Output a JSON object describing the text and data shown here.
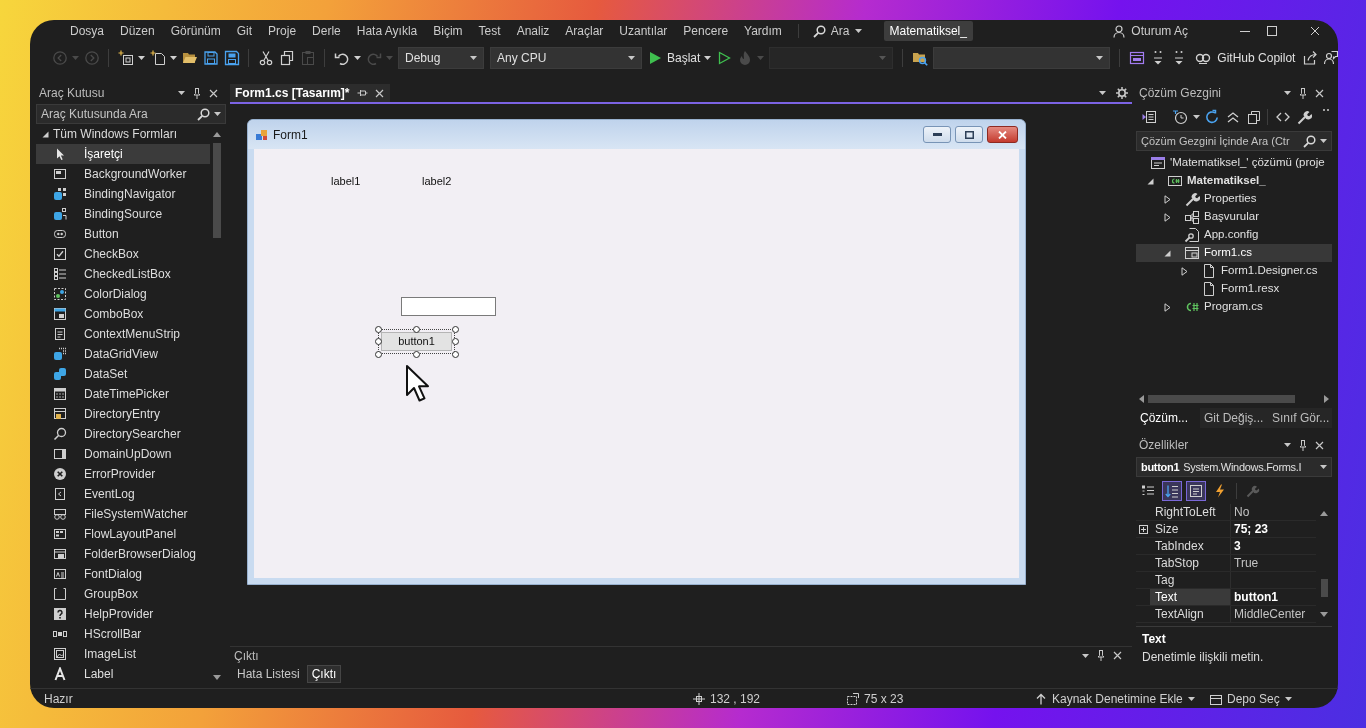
{
  "menu_bar": {
    "items": [
      "Dosya",
      "Düzen",
      "Görünüm",
      "Git",
      "Proje",
      "Derle",
      "Hata Ayıkla",
      "Biçim",
      "Test",
      "Analiz",
      "Araçlar",
      "Uzantılar",
      "Pencere",
      "Yardım"
    ],
    "search": "Ara",
    "solution": "Matematiksel_",
    "account": "Oturum Aç"
  },
  "toolbar": {
    "items": [
      {
        "kind": "back",
        "disabled": true,
        "dropdown": true
      },
      {
        "kind": "forward",
        "disabled": true,
        "dropdown": false
      },
      {
        "kind": "separator"
      },
      {
        "kind": "new-project",
        "disabled": false,
        "dropdown": true
      },
      {
        "kind": "new-item",
        "disabled": false,
        "dropdown": true
      },
      {
        "kind": "open",
        "disabled": false,
        "dropdown": false
      },
      {
        "kind": "save",
        "disabled": false,
        "dropdown": false
      },
      {
        "kind": "save-all",
        "disabled": false,
        "dropdown": false
      },
      {
        "kind": "separator"
      },
      {
        "kind": "cut",
        "disabled": false,
        "dropdown": false
      },
      {
        "kind": "copy",
        "disabled": false,
        "dropdown": false
      },
      {
        "kind": "paste",
        "disabled": true,
        "dropdown": false
      },
      {
        "kind": "separator"
      },
      {
        "kind": "undo",
        "disabled": false,
        "dropdown": true
      },
      {
        "kind": "redo",
        "disabled": true,
        "dropdown": true
      },
      {
        "kind": "combo",
        "value": "Debug",
        "disabled": false
      },
      {
        "kind": "combo",
        "value": "Any CPU",
        "disabled": false
      },
      {
        "kind": "start",
        "label": "Başlat",
        "disabled": false,
        "dropdown": true
      },
      {
        "kind": "run",
        "disabled": false,
        "dropdown": false
      },
      {
        "kind": "hot-reload",
        "disabled": true,
        "dropdown": true
      },
      {
        "kind": "combo",
        "disabled": true
      },
      {
        "kind": "separator"
      },
      {
        "kind": "find",
        "disabled": false,
        "dropdown": false
      },
      {
        "kind": "combo",
        "disabled": false
      },
      {
        "kind": "separator"
      },
      {
        "kind": "layout",
        "disabled": false,
        "dropdown": false
      },
      {
        "kind": "overflow",
        "disabled": false,
        "dropdown": false
      },
      {
        "kind": "overflow",
        "disabled": false,
        "dropdown": false
      },
      {
        "kind": "copilot",
        "label": "GitHub Copilot",
        "disabled": false,
        "dropdown": false
      },
      {
        "kind": "share",
        "disabled": false,
        "dropdown": false
      },
      {
        "kind": "feedback",
        "disabled": false,
        "dropdown": false
      }
    ]
  },
  "toolbox": {
    "title": "Araç Kutusu",
    "search": {
      "placeholder": "Araç Kutusunda Ara"
    },
    "group": {
      "label": "Tüm Windows Formları",
      "expanded": true
    },
    "items": [
      {
        "label": "İşaretçi",
        "selected": true
      },
      {
        "label": "BackgroundWorker",
        "selected": false
      },
      {
        "label": "BindingNavigator",
        "selected": false
      },
      {
        "label": "BindingSource",
        "selected": false
      },
      {
        "label": "Button",
        "selected": false
      },
      {
        "label": "CheckBox",
        "selected": false
      },
      {
        "label": "CheckedListBox",
        "selected": false
      },
      {
        "label": "ColorDialog",
        "selected": false
      },
      {
        "label": "ComboBox",
        "selected": false
      },
      {
        "label": "ContextMenuStrip",
        "selected": false
      },
      {
        "label": "DataGridView",
        "selected": false
      },
      {
        "label": "DataSet",
        "selected": false
      },
      {
        "label": "DateTimePicker",
        "selected": false
      },
      {
        "label": "DirectoryEntry",
        "selected": false
      },
      {
        "label": "DirectorySearcher",
        "selected": false
      },
      {
        "label": "DomainUpDown",
        "selected": false
      },
      {
        "label": "ErrorProvider",
        "selected": false
      },
      {
        "label": "EventLog",
        "selected": false
      },
      {
        "label": "FileSystemWatcher",
        "selected": false
      },
      {
        "label": "FlowLayoutPanel",
        "selected": false
      },
      {
        "label": "FolderBrowserDialog",
        "selected": false
      },
      {
        "label": "FontDialog",
        "selected": false
      },
      {
        "label": "GroupBox",
        "selected": false
      },
      {
        "label": "HelpProvider",
        "selected": false
      },
      {
        "label": "HScrollBar",
        "selected": false
      },
      {
        "label": "ImageList",
        "selected": false
      },
      {
        "label": "Label",
        "selected": false
      }
    ]
  },
  "editor": {
    "tabs": [
      {
        "label": "Form1.cs [Tasarım]*",
        "selected": true
      }
    ],
    "form": {
      "title": "Form1",
      "labels": [
        "label1",
        "label2"
      ],
      "button": {
        "label": "button1",
        "selected": true
      }
    }
  },
  "output": {
    "title": "Çıktı",
    "tabs": [
      {
        "label": "Hata Listesi",
        "selected": false
      },
      {
        "label": "Çıktı",
        "selected": true
      }
    ]
  },
  "solution_explorer": {
    "title": "Çözüm Gezgini",
    "search": {
      "placeholder": "Çözüm Gezgini İçinde Ara (Ctr"
    },
    "tree": [
      {
        "label": "'Matematiksel_' çözümü (proje",
        "kind": "solution",
        "selected": false,
        "children": [
          {
            "label": "Matematiksel_",
            "kind": "project",
            "expanded": true,
            "selected": false,
            "children": [
              {
                "label": "Properties",
                "kind": "properties",
                "expanded": false,
                "selected": false
              },
              {
                "label": "Başvurular",
                "kind": "references",
                "expanded": false,
                "selected": false
              },
              {
                "label": "App.config",
                "kind": "config",
                "selected": false
              },
              {
                "label": "Form1.cs",
                "kind": "form",
                "expanded": true,
                "selected": true,
                "children": [
                  {
                    "label": "Form1.Designer.cs",
                    "kind": "file",
                    "expanded": false,
                    "selected": false
                  },
                  {
                    "label": "Form1.resx",
                    "kind": "file",
                    "selected": false
                  }
                ]
              },
              {
                "label": "Program.cs",
                "kind": "csharp",
                "expanded": false,
                "selected": false
              }
            ]
          }
        ]
      }
    ],
    "tabs": [
      {
        "label": "Çözüm...",
        "selected": true
      },
      {
        "label": "Git Değiş...",
        "selected": false
      },
      {
        "label": "Sınıf Gör...",
        "selected": false
      }
    ]
  },
  "properties": {
    "title": "Özellikler",
    "object": {
      "name": "button1",
      "type": "System.Windows.Forms.I"
    },
    "tools": [
      {
        "kind": "categorized",
        "selected": false,
        "disabled": false
      },
      {
        "kind": "alphabetical",
        "selected": true,
        "disabled": false
      },
      {
        "kind": "properties",
        "selected": true,
        "disabled": false
      },
      {
        "kind": "events",
        "selected": false,
        "disabled": false
      },
      {
        "kind": "pages",
        "selected": false,
        "disabled": true
      }
    ],
    "rows": [
      {
        "name": "RightToLeft",
        "value": "No",
        "modified": false,
        "selected": false
      },
      {
        "name": "Size",
        "value": "75; 23",
        "modified": true,
        "expanded": false,
        "selected": false
      },
      {
        "name": "TabIndex",
        "value": "3",
        "modified": true,
        "selected": false
      },
      {
        "name": "TabStop",
        "value": "True",
        "modified": false,
        "selected": false
      },
      {
        "name": "Tag",
        "selected": false
      },
      {
        "name": "Text",
        "value": "button1",
        "modified": true,
        "selected": true
      },
      {
        "name": "TextAlign",
        "value": "MiddleCenter",
        "modified": false,
        "selected": false
      }
    ],
    "description": {
      "title": "Text",
      "text": "Denetimle ilişkili metin."
    }
  },
  "status_bar": {
    "message": "Hazır",
    "position": "132 , 192",
    "size": "75 x 23",
    "source_control": "Kaynak Denetimine Ekle",
    "repository": "Depo Seç"
  }
}
